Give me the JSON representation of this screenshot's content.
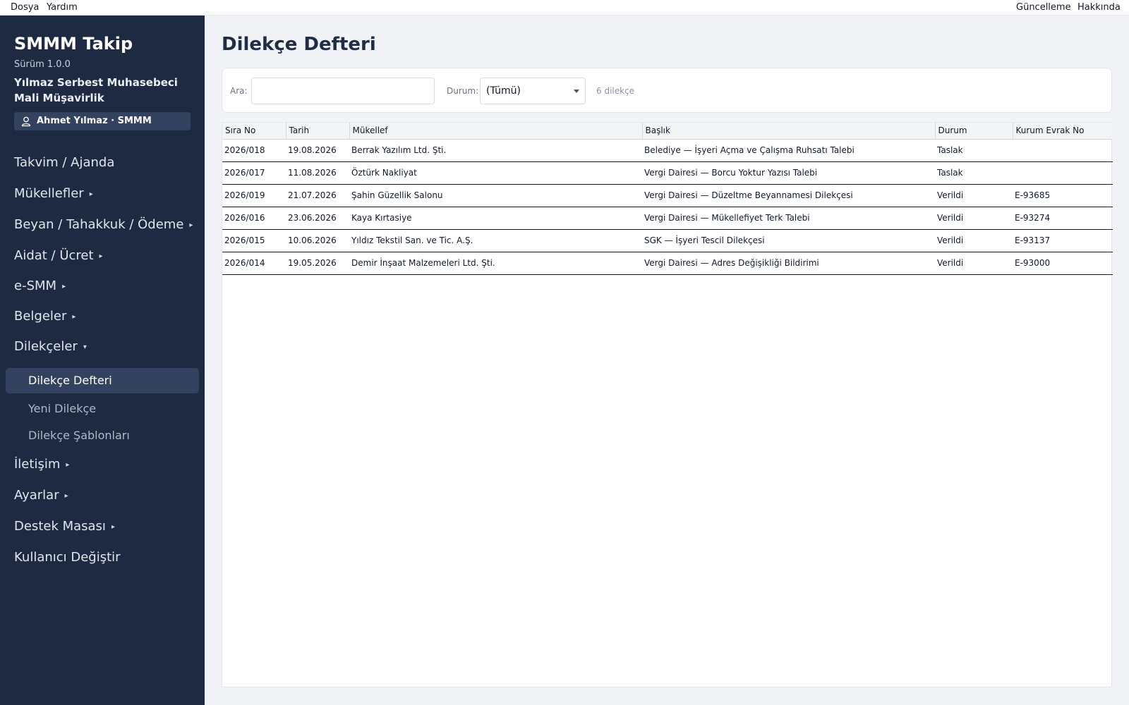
{
  "menubar": {
    "left": [
      "Dosya",
      "Yardım"
    ],
    "right": [
      "Güncelleme",
      "Hakkında"
    ]
  },
  "sidebar": {
    "app_title": "SMMM Takip",
    "version": "Sürüm 1.0.0",
    "company": "Yılmaz Serbest Muhasebeci Mali Müşavirlik",
    "user": "Ahmet Yılmaz · SMMM",
    "items": [
      {
        "label": "Takvim / Ajanda",
        "arrow": ""
      },
      {
        "label": "Mükellefler",
        "arrow": "▸"
      },
      {
        "label": "Beyan / Tahakkuk / Ödeme",
        "arrow": "▸"
      },
      {
        "label": "Aidat / Ücret",
        "arrow": "▸"
      },
      {
        "label": "e-SMM",
        "arrow": "▸"
      },
      {
        "label": "Belgeler",
        "arrow": "▸"
      },
      {
        "label": "Dilekçeler",
        "arrow": "▾"
      },
      {
        "label": "İletişim",
        "arrow": "▸"
      },
      {
        "label": "Ayarlar",
        "arrow": "▸"
      },
      {
        "label": "Destek Masası",
        "arrow": "▸"
      },
      {
        "label": "Kullanıcı Değiştir",
        "arrow": ""
      }
    ],
    "sub_items": [
      "Dilekçe Defteri",
      "Yeni Dilekçe",
      "Dilekçe Şablonları"
    ]
  },
  "main": {
    "title": "Dilekçe Defteri",
    "search_label": "Ara:",
    "search_value": "",
    "status_label": "Durum:",
    "status_value": "(Tümü)",
    "count": "6 dilekçe",
    "columns": [
      "Sıra No",
      "Tarih",
      "Mükellef",
      "Başlık",
      "Durum",
      "Kurum Evrak No"
    ],
    "rows": [
      [
        "2026/018",
        "19.08.2026",
        "Berrak Yazılım Ltd. Şti.",
        "Belediye — İşyeri Açma ve Çalışma Ruhsatı Talebi",
        "Taslak",
        ""
      ],
      [
        "2026/017",
        "11.08.2026",
        "Öztürk Nakliyat",
        "Vergi Dairesi — Borcu Yoktur Yazısı Talebi",
        "Taslak",
        ""
      ],
      [
        "2026/019",
        "21.07.2026",
        "Şahin Güzellik Salonu",
        "Vergi Dairesi — Düzeltme Beyannamesi Dilekçesi",
        "Verildi",
        "E-93685"
      ],
      [
        "2026/016",
        "23.06.2026",
        "Kaya Kırtasiye",
        "Vergi Dairesi — Mükellefiyet Terk Talebi",
        "Verildi",
        "E-93274"
      ],
      [
        "2026/015",
        "10.06.2026",
        "Yıldız Tekstil San. ve Tic. A.Ş.",
        "SGK — İşyeri Tescil Dilekçesi",
        "Verildi",
        "E-93137"
      ],
      [
        "2026/014",
        "19.05.2026",
        "Demir İnşaat Malzemeleri Ltd. Şti.",
        "Vergi Dairesi — Adres Değişikliği Bildirimi",
        "Verildi",
        "E-93000"
      ]
    ]
  }
}
